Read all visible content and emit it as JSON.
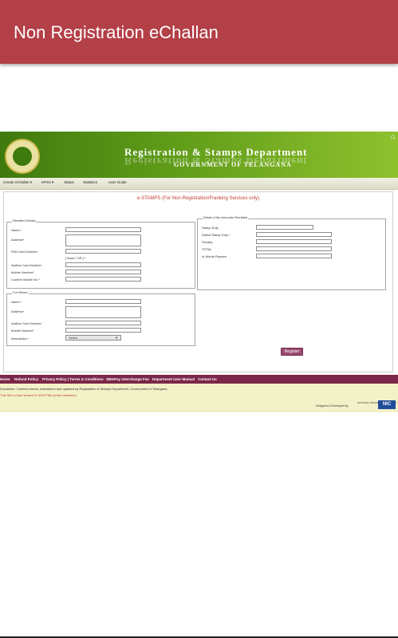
{
  "app": {
    "title": "Non Registration eChallan"
  },
  "site": {
    "dept_title": "Registration & Stamps Department",
    "govt": "GOVERNMENT OF TELANGANA",
    "nav": [
      "Create eChallan ▾",
      "ePrint ▾",
      "Status",
      "Statistics",
      "User Guide"
    ],
    "headline": "e-STAMPS (For Non-Registration/Franking Services only)"
  },
  "remitter": {
    "legend": "Remitter Details",
    "name": "Name *",
    "address": "Address*",
    "pan": "PAN Card Number",
    "pan_hint": "[ Aand / OR ] *",
    "aadhar": "Aadhar Card Number",
    "mobile": "Mobile Number*",
    "confirm_mobile": "Confirm Mobile No *"
  },
  "for_whom": {
    "legend": "For Whom",
    "name": "Name *",
    "address": "Address*",
    "aadhar": "Aadhar Card Number",
    "mobile": "Mobile Number*",
    "description": "Description *",
    "description_value": "Select"
  },
  "amounts": {
    "legend": "Detail of the Amounts Remitted",
    "stamp_duty": "Stamp Duty",
    "deficit": "Deficit Stamp Duty *",
    "penalty": "Penalty",
    "total": "TOTAL",
    "in_words": "In Words Rupees"
  },
  "register_label": "Register",
  "footer": {
    "links": [
      "Home",
      "Refund Policy",
      "Privacy Policy | Terms & Conditions",
      "SBIePay Interchange Fee",
      "Department User Manual",
      "Contact Us"
    ],
    "disclaimer": "Disclaimer: Content owned, maintained and updated by Registration & Stamps Department, Government of Telangana.",
    "best_view": "This Site is best viewed in 1024*768 screen resolution",
    "developed": "Designed & Developed by",
    "nic_small": "NATIONAL INFORMATICS CENTRE",
    "nic": "NIC"
  },
  "colors": {
    "appbar": "#b33f47",
    "banner": "#5d9a18",
    "footer_nav": "#7b2749",
    "button": "#9a4b6e"
  }
}
